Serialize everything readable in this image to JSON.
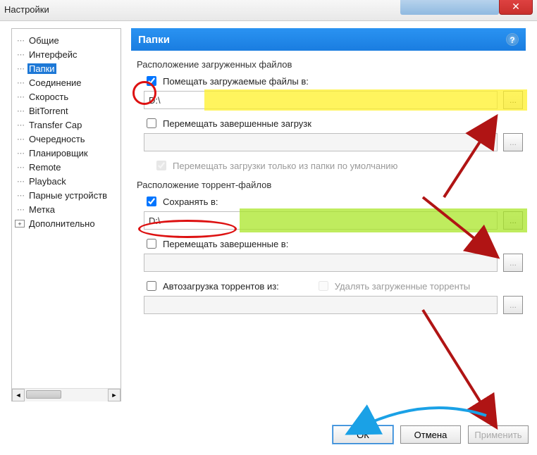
{
  "window": {
    "title": "Настройки"
  },
  "tree": {
    "items": [
      {
        "label": "Общие",
        "selected": false,
        "expand": false
      },
      {
        "label": "Интерфейс",
        "selected": false,
        "expand": false
      },
      {
        "label": "Папки",
        "selected": true,
        "expand": false
      },
      {
        "label": "Соединение",
        "selected": false,
        "expand": false
      },
      {
        "label": "Скорость",
        "selected": false,
        "expand": false
      },
      {
        "label": "BitTorrent",
        "selected": false,
        "expand": false
      },
      {
        "label": "Transfer Cap",
        "selected": false,
        "expand": false
      },
      {
        "label": "Очередность",
        "selected": false,
        "expand": false
      },
      {
        "label": "Планировщик",
        "selected": false,
        "expand": false
      },
      {
        "label": "Remote",
        "selected": false,
        "expand": false
      },
      {
        "label": "Playback",
        "selected": false,
        "expand": false
      },
      {
        "label": "Парные устройств",
        "selected": false,
        "expand": false
      },
      {
        "label": "Метка",
        "selected": false,
        "expand": false
      },
      {
        "label": "Дополнительно",
        "selected": false,
        "expand": true
      }
    ]
  },
  "panel": {
    "title": "Папки"
  },
  "sections": {
    "downloads_title": "Расположение загруженных файлов",
    "put_new": {
      "checked": true,
      "label": "Помещать загружаемые файлы в:",
      "path": "D:\\"
    },
    "move_completed": {
      "checked": false,
      "label": "Перемещать завершенные загрузк",
      "path": ""
    },
    "only_default": {
      "checked": true,
      "disabled": true,
      "label": "Перемещать загрузки только из папки по умолчанию"
    },
    "torrents_title": "Расположение торрент-файлов",
    "save_in": {
      "checked": true,
      "label": "Сохранять в:",
      "path": "D:\\"
    },
    "move_torrents": {
      "checked": false,
      "label": "Перемещать завершенные в:",
      "path": ""
    },
    "autoload": {
      "checked": false,
      "label": "Автозагрузка торрентов из:",
      "path": ""
    },
    "delete_loaded": {
      "checked": false,
      "disabled": true,
      "label": "Удалять загруженные торренты"
    }
  },
  "buttons": {
    "ok": "ОК",
    "cancel": "Отмена",
    "apply": "Применить"
  },
  "browse_label": "..."
}
